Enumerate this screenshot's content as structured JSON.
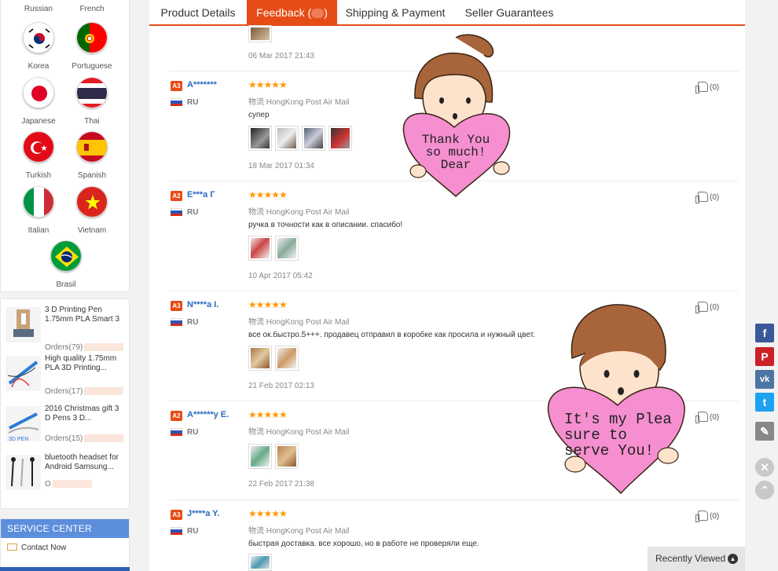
{
  "languages": {
    "top_labels": [
      "Russian",
      "French"
    ],
    "items": [
      {
        "name": "Korea",
        "flag": "korea-flag-icon"
      },
      {
        "name": "Portuguese",
        "flag": "portugal-flag-icon"
      },
      {
        "name": "Japanese",
        "flag": "japan-flag-icon"
      },
      {
        "name": "Thai",
        "flag": "thailand-flag-icon"
      },
      {
        "name": "Turkish",
        "flag": "turkey-flag-icon"
      },
      {
        "name": "Spanish",
        "flag": "spain-flag-icon"
      },
      {
        "name": "Italian",
        "flag": "italy-flag-icon"
      },
      {
        "name": "Vietnam",
        "flag": "vietnam-flag-icon"
      },
      {
        "name": "Brasil",
        "flag": "brazil-flag-icon"
      }
    ]
  },
  "products": [
    {
      "title": "3 D Printing Pen 1.75mm PLA Smart 3",
      "orders": "Orders(79)"
    },
    {
      "title": "High quality 1.75mm PLA 3D Printing...",
      "orders": "Orders(17)"
    },
    {
      "title": "2016 Christmas gift 3 D Pens 3 D...",
      "orders": "Orders(15)"
    },
    {
      "title": "bluetooth headset for Android Samsung...",
      "orders": "O"
    }
  ],
  "service": {
    "header": "SERVICE CENTER",
    "contact": "Contact Now"
  },
  "tabs": [
    {
      "label": "Product Details"
    },
    {
      "label": "Feedback ("
    },
    {
      "label": "Shipping & Payment"
    },
    {
      "label": "Seller Guarantees"
    }
  ],
  "tab_closing": ")",
  "first_review_date": "06 Mar 2017 21:43",
  "reviews": [
    {
      "level": "A3",
      "name": "A*******",
      "country": "RU",
      "stars": "★★★★★",
      "shipping": "物流 HongKong Post Air Mail",
      "text": "супер",
      "date": "18 Mar 2017 01:34",
      "helpful": "(0)"
    },
    {
      "level": "A2",
      "name": "E***a Г",
      "country": "RU",
      "stars": "★★★★★",
      "shipping": "物流 HongKong Post Air Mail",
      "text": "ручка в точности как в описании. спасибо!",
      "date": "10 Apr 2017 05:42",
      "helpful": "(0)"
    },
    {
      "level": "A3",
      "name": "N****a I.",
      "country": "RU",
      "stars": "★★★★★",
      "shipping": "物流 HongKong Post Air Mail",
      "text": "все ок.быстро.5+++. продавец отправил в коробке как просила и нужный цвет.",
      "date": "21 Feb 2017 02:13",
      "helpful": "(0)"
    },
    {
      "level": "A2",
      "name": "A******y E.",
      "country": "RU",
      "stars": "★★★★★",
      "shipping": "物流 HongKong Post Air Mail",
      "text": "",
      "date": "22 Feb 2017 21:38",
      "helpful": "(0)"
    },
    {
      "level": "A3",
      "name": "J****a Y.",
      "country": "RU",
      "stars": "★★★★★",
      "shipping": "物流 HongKong Post Air Mail",
      "text": "быстрая доставка. все хорошо, но в работе не проверяли еще.",
      "date": "",
      "helpful": "(0)"
    }
  ],
  "stickers": {
    "girl": [
      "Thank You",
      "so much!",
      "Dear"
    ],
    "boy": [
      "It's my Plea",
      "sure to",
      "serve You!"
    ]
  },
  "share": [
    {
      "name": "facebook",
      "glyph": "f",
      "color": "#3b5998"
    },
    {
      "name": "pinterest",
      "glyph": "P",
      "color": "#cb2027"
    },
    {
      "name": "vk",
      "glyph": "vk",
      "color": "#4c75a3"
    },
    {
      "name": "twitter",
      "glyph": "t",
      "color": "#1da1f2"
    },
    {
      "name": "edit",
      "glyph": "✎",
      "color": "#888888"
    }
  ],
  "recently_viewed": "Recently Viewed",
  "colors": {
    "accent": "#e64c15",
    "link": "#2a6bbf",
    "star": "#ff9900",
    "service": "#5c8edc"
  }
}
